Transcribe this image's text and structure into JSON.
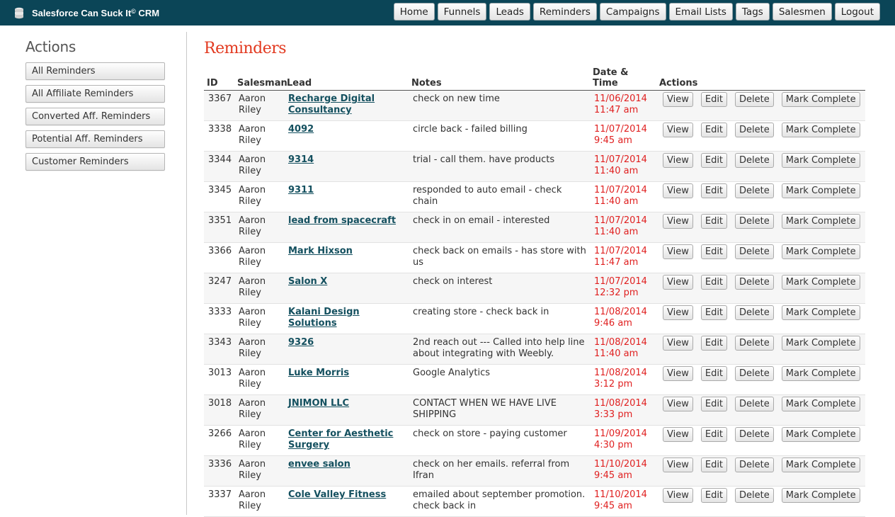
{
  "app": {
    "name": "Salesforce Can Suck It",
    "name_sup": "©",
    "name_suffix": " CRM"
  },
  "nav": [
    "Home",
    "Funnels",
    "Leads",
    "Reminders",
    "Campaigns",
    "Email Lists",
    "Tags",
    "Salesmen",
    "Logout"
  ],
  "sidebar": {
    "title": "Actions",
    "items": [
      "All Reminders",
      "All Affiliate Reminders",
      "Converted Aff. Reminders",
      "Potential Aff. Reminders",
      "Customer Reminders"
    ]
  },
  "page": {
    "title": "Reminders"
  },
  "table": {
    "columns": [
      "ID",
      "Salesman",
      "Lead",
      "Notes",
      "Date & Time",
      "Actions"
    ],
    "action_labels": [
      "View",
      "Edit",
      "Delete",
      "Mark Complete"
    ],
    "rows": [
      {
        "id": "3367",
        "salesman": "Aaron Riley",
        "lead": "Recharge Digital Consultancy",
        "notes": "check on new time",
        "date": "11/06/2014",
        "time": "11:47 am"
      },
      {
        "id": "3338",
        "salesman": "Aaron Riley",
        "lead": "4092",
        "notes": "circle back - failed billing",
        "date": "11/07/2014",
        "time": "9:45 am"
      },
      {
        "id": "3344",
        "salesman": "Aaron Riley",
        "lead": "9314",
        "notes": "trial - call them. have products",
        "date": "11/07/2014",
        "time": "11:40 am"
      },
      {
        "id": "3345",
        "salesman": "Aaron Riley",
        "lead": "9311",
        "notes": "responded to auto email - check chain",
        "date": "11/07/2014",
        "time": "11:40 am"
      },
      {
        "id": "3351",
        "salesman": "Aaron Riley",
        "lead": "lead from spacecraft",
        "notes": "check in on email - interested",
        "date": "11/07/2014",
        "time": "11:40 am"
      },
      {
        "id": "3366",
        "salesman": "Aaron Riley",
        "lead": "Mark Hixson",
        "notes": "check back on emails - has store with us",
        "date": "11/07/2014",
        "time": "11:47 am"
      },
      {
        "id": "3247",
        "salesman": "Aaron Riley",
        "lead": "Salon X",
        "notes": "check on interest",
        "date": "11/07/2014",
        "time": "12:32 pm"
      },
      {
        "id": "3333",
        "salesman": "Aaron Riley",
        "lead": "Kalani Design Solutions",
        "notes": "creating store - check back in",
        "date": "11/08/2014",
        "time": "9:46 am"
      },
      {
        "id": "3343",
        "salesman": "Aaron Riley",
        "lead": "9326",
        "notes": "2nd reach out --- Called into help line about integrating with Weebly.",
        "date": "11/08/2014",
        "time": "11:40 am"
      },
      {
        "id": "3013",
        "salesman": "Aaron Riley",
        "lead": "Luke Morris",
        "notes": "Google Analytics",
        "date": "11/08/2014",
        "time": "3:12 pm"
      },
      {
        "id": "3018",
        "salesman": "Aaron Riley",
        "lead": "JNIMON LLC",
        "notes": "CONTACT WHEN WE HAVE LIVE SHIPPING",
        "date": "11/08/2014",
        "time": "3:33 pm"
      },
      {
        "id": "3266",
        "salesman": "Aaron Riley",
        "lead": "Center for Aesthetic Surgery",
        "notes": "check on store - paying customer",
        "date": "11/09/2014",
        "time": "4:30 pm"
      },
      {
        "id": "3336",
        "salesman": "Aaron Riley",
        "lead": "envee salon",
        "notes": "check on her emails. referral from Ifran",
        "date": "11/10/2014",
        "time": "9:45 am"
      },
      {
        "id": "3337",
        "salesman": "Aaron Riley",
        "lead": "Cole Valley Fitness",
        "notes": "emailed about september promotion. check back in",
        "date": "11/10/2014",
        "time": "9:45 am"
      }
    ]
  },
  "colors": {
    "topbar": "#0b4557",
    "title": "#e2391f",
    "datetime": "#e02020",
    "lead_link": "#14505f"
  },
  "icons": {
    "logo": "database-stack-icon"
  }
}
